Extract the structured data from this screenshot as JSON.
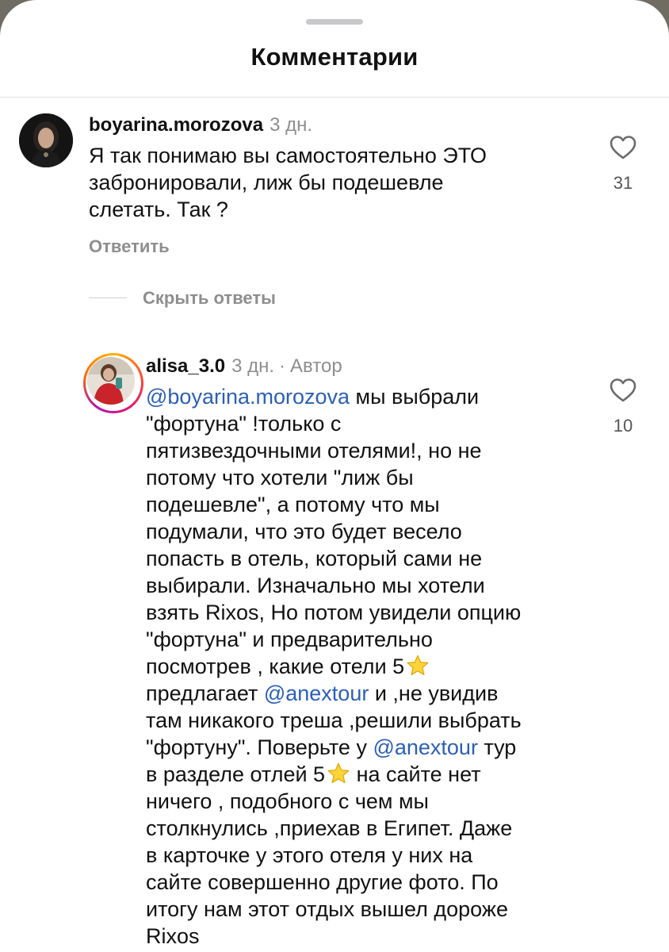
{
  "header": {
    "title": "Комментарии"
  },
  "comments": [
    {
      "username": "boyarina.morozova",
      "time": "3 дн.",
      "lines": [
        "Я так понимаю вы самостоятельно ЭТО",
        "забронировали, лиж бы подешевле",
        "слетать. Так ?"
      ],
      "likes": "31",
      "reply_label": "Ответить"
    }
  ],
  "replies_toggle": {
    "label": "Скрыть ответы"
  },
  "reply": {
    "username": "alisa_3.0",
    "time": "3 дн.",
    "separator": "·",
    "author_label": "Автор",
    "likes": "10",
    "lines": [
      {
        "mention": "@boyarina.morozova",
        "text": " мы выбрали"
      },
      {
        "text": "\"фортуна\" !только с"
      },
      {
        "text": "пятизвездочными отелями!, но не"
      },
      {
        "text": "потому что хотели \"лиж бы"
      },
      {
        "text": "подешевле\", а потому что мы"
      },
      {
        "text": "подумали, что это будет весело"
      },
      {
        "text": "попасть в отель, который сами не"
      },
      {
        "text": "выбирали. Изначально мы хотели"
      },
      {
        "text": "взять Rixos, Но потом увидели опцию"
      },
      {
        "text": "\"фортуна\" и предварительно"
      },
      {
        "text": "посмотрев , какие отели 5",
        "star": true
      },
      {
        "text": "предлагает ",
        "mention": "@anextour",
        "after": " и ,не увидив"
      },
      {
        "text": "там никакого треша ,решили выбрать"
      },
      {
        "text": "\"фортуну\". Поверьте у ",
        "mention": "@anextour",
        "after": " тур"
      },
      {
        "text": "в разделе отлей 5",
        "star": true,
        "after": " на сайте нет"
      },
      {
        "text": "ничего , подобного с чем мы"
      },
      {
        "text": "столкнулись ,приехав в Египет. Даже"
      },
      {
        "text": "в карточке у этого отеля у них на"
      },
      {
        "text": "сайте совершенно другие фото. По"
      },
      {
        "text": "итогу нам этот отдых вышел дороже"
      },
      {
        "text": "Rixos"
      }
    ]
  },
  "icons": {
    "like": "heart-outline-icon",
    "star": "star-emoji-icon"
  },
  "colors": {
    "mention": "#2b5fb8",
    "secondary_text": "#8e8e8e"
  }
}
